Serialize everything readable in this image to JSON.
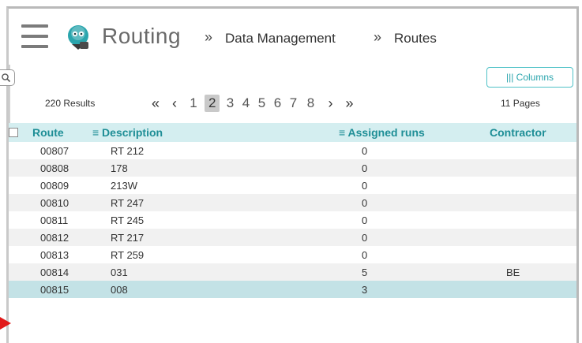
{
  "header": {
    "app_name": "Routing",
    "sep1": "»",
    "crumb1": "Data Management",
    "sep2": "»",
    "crumb2": "Routes"
  },
  "toolbar": {
    "columns_label": "||| Columns",
    "results": "220 Results",
    "pages": "11 Pages"
  },
  "pager": {
    "first": "«",
    "prev": "‹",
    "next": "›",
    "last": "»",
    "numbers": [
      "1",
      "2",
      "3",
      "4",
      "5",
      "6",
      "7",
      "8"
    ],
    "current": "2"
  },
  "table": {
    "headers": {
      "route": "Route",
      "description": "≡ Description",
      "runs": "≡ Assigned runs",
      "contractor": "Contractor"
    },
    "rows": [
      {
        "route": "00807",
        "description": "RT 212",
        "runs": "0",
        "contractor": ""
      },
      {
        "route": "00808",
        "description": "178",
        "runs": "0",
        "contractor": ""
      },
      {
        "route": "00809",
        "description": "213W",
        "runs": "0",
        "contractor": ""
      },
      {
        "route": "00810",
        "description": "RT 247",
        "runs": "0",
        "contractor": ""
      },
      {
        "route": "00811",
        "description": "RT 245",
        "runs": "0",
        "contractor": ""
      },
      {
        "route": "00812",
        "description": "RT 217",
        "runs": "0",
        "contractor": ""
      },
      {
        "route": "00813",
        "description": "RT 259",
        "runs": "0",
        "contractor": ""
      },
      {
        "route": "00814",
        "description": "031",
        "runs": "5",
        "contractor": "BE"
      },
      {
        "route": "00815",
        "description": "008",
        "runs": "3",
        "contractor": ""
      }
    ],
    "selected_index": 8
  },
  "colors": {
    "accent": "#2aa5ad",
    "header_bg": "#d4eef0",
    "selected_row": "#c3e2e6",
    "marker": "#e11a1a"
  }
}
